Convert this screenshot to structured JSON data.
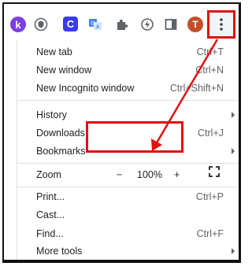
{
  "toolbar": {
    "extensions": [
      {
        "name": "k-extension-icon",
        "glyph": "k",
        "color": "#7b3fe4"
      },
      {
        "name": "shield-extension-icon"
      },
      {
        "name": "c-extension-icon",
        "glyph": "C",
        "color": "#3b3bf0"
      },
      {
        "name": "translate-icon"
      },
      {
        "name": "puzzle-icon"
      },
      {
        "name": "speed-icon"
      },
      {
        "name": "side-panel-icon"
      }
    ],
    "avatar_initial": "T",
    "avatar_color": "#c0502a",
    "menu_button_icon": "vertical-ellipsis-icon"
  },
  "menu": {
    "group1": [
      {
        "label": "New tab",
        "shortcut": "Ctrl+T"
      },
      {
        "label": "New window",
        "shortcut": "Ctrl+N"
      },
      {
        "label": "New Incognito window",
        "shortcut": "Ctrl+Shift+N"
      }
    ],
    "group2": [
      {
        "label": "History",
        "submenu": true
      },
      {
        "label": "Downloads",
        "shortcut": "Ctrl+J"
      },
      {
        "label": "Bookmarks",
        "submenu": true
      }
    ],
    "zoom": {
      "label": "Zoom",
      "minus": "−",
      "value": "100%",
      "plus": "+",
      "fullscreen_icon": "fullscreen-icon"
    },
    "group3": [
      {
        "label": "Print...",
        "shortcut": "Ctrl+P"
      },
      {
        "label": "Cast..."
      },
      {
        "label": "Find...",
        "shortcut": "Ctrl+F"
      },
      {
        "label": "More tools",
        "submenu": true
      }
    ]
  },
  "annotation": {
    "highlight_color": "#e01010"
  }
}
